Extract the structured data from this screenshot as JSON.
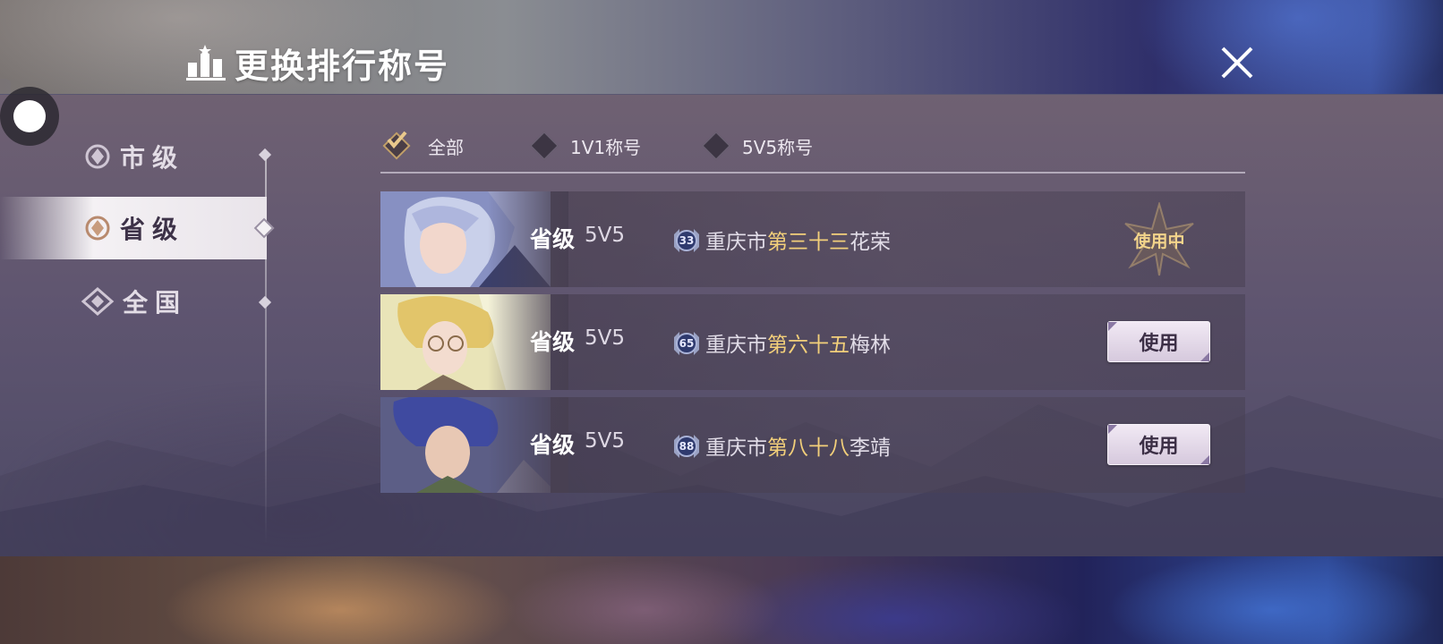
{
  "header": {
    "title": "更换排行称号",
    "title_icon": "ranking-podium-icon",
    "close_icon": "close-icon"
  },
  "sidebar": {
    "items": [
      {
        "label": "市级",
        "icon": "city-emblem-icon",
        "active": false
      },
      {
        "label": "省级",
        "icon": "province-emblem-icon",
        "active": true
      },
      {
        "label": "全国",
        "icon": "national-emblem-icon",
        "active": false
      }
    ]
  },
  "filters": [
    {
      "label": "全部",
      "checked": true
    },
    {
      "label": "1V1称号",
      "checked": false
    },
    {
      "label": "5V5称号",
      "checked": false
    }
  ],
  "rows": [
    {
      "level": "省级",
      "mode": "5V5",
      "badge": "33",
      "city": "重庆市",
      "rank": "第三十三",
      "hero": "花荣",
      "action": "使用中",
      "in_use": true,
      "portrait": "silver-hair-hero"
    },
    {
      "level": "省级",
      "mode": "5V5",
      "badge": "65",
      "city": "重庆市",
      "rank": "第六十五",
      "hero": "梅林",
      "action": "使用",
      "in_use": false,
      "portrait": "blonde-glasses-hero"
    },
    {
      "level": "省级",
      "mode": "5V5",
      "badge": "88",
      "city": "重庆市",
      "rank": "第八十八",
      "hero": "李靖",
      "action": "使用",
      "in_use": false,
      "portrait": "blue-hair-hero"
    }
  ],
  "colors": {
    "rank_highlight": "#f2cf7a",
    "in_use_gold": "#f3d48b",
    "button_bg": "#e6dcea"
  }
}
